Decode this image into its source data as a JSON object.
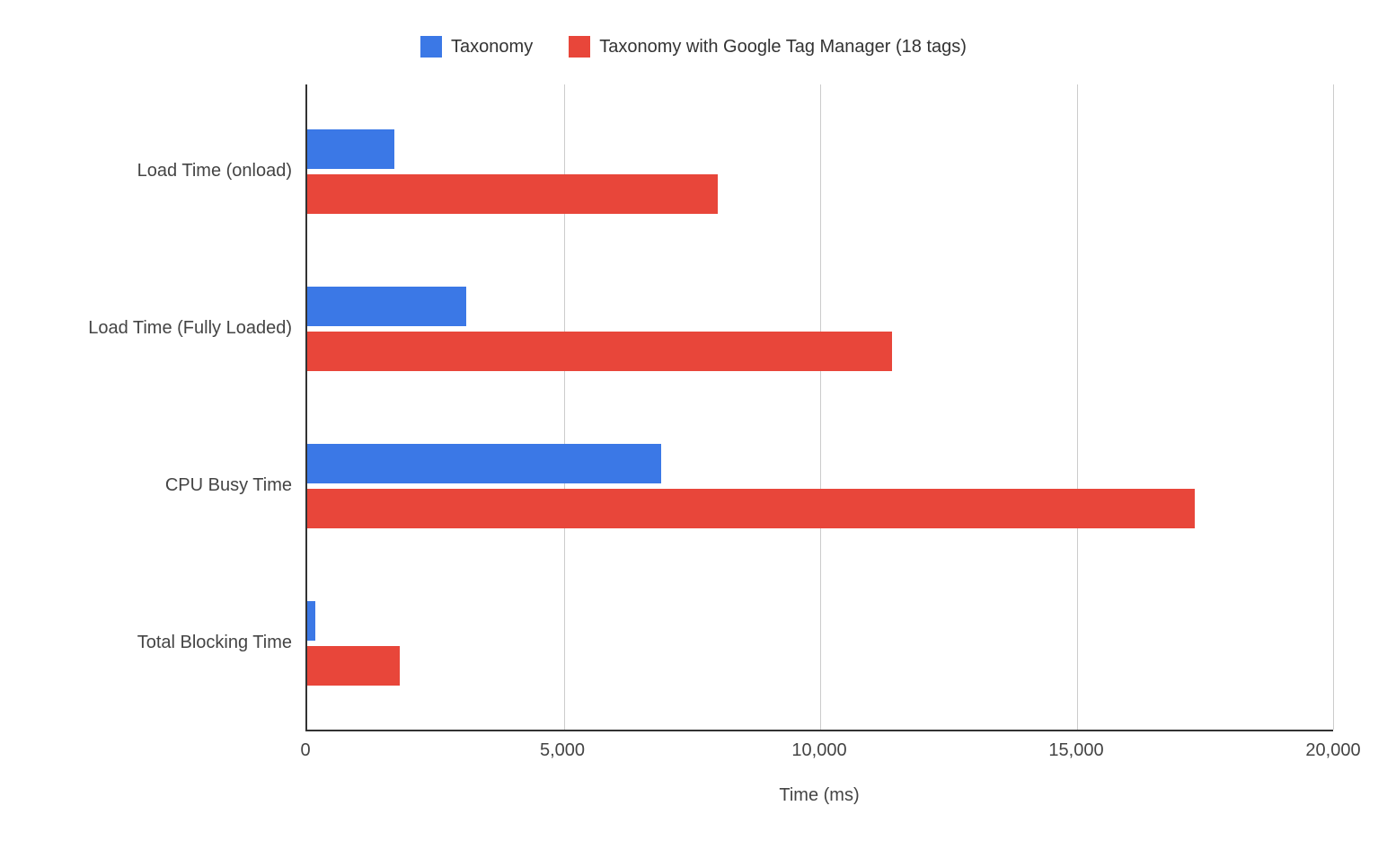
{
  "chart_data": {
    "type": "bar",
    "orientation": "horizontal",
    "categories": [
      "Load Time (onload)",
      "Load Time (Fully Loaded)",
      "CPU Busy Time",
      "Total Blocking Time"
    ],
    "series": [
      {
        "name": "Taxonomy",
        "values": [
          1700,
          3100,
          6900,
          150
        ],
        "color": "#3b78e6"
      },
      {
        "name": "Taxonomy with Google Tag Manager (18 tags)",
        "values": [
          8000,
          11400,
          17300,
          1800
        ],
        "color": "#e8463a"
      }
    ],
    "xlabel": "Time (ms)",
    "ylabel": "",
    "xlim": [
      0,
      20000
    ],
    "x_ticks": [
      0,
      5000,
      10000,
      15000,
      20000
    ],
    "x_tick_labels": [
      "0",
      "5,000",
      "10,000",
      "15,000",
      "20,000"
    ]
  }
}
